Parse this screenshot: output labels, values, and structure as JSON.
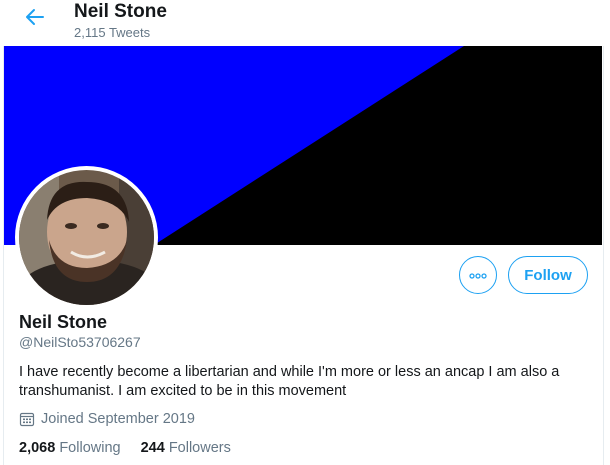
{
  "header": {
    "title": "Neil Stone",
    "subtitle": "2,115 Tweets",
    "back_icon": "arrow-left-icon"
  },
  "banner": {
    "colors": [
      "#0000ff",
      "#000000"
    ]
  },
  "profile": {
    "name": "Neil Stone",
    "handle": "@NeilSto53706267",
    "bio": "I have recently become a libertarian and while I'm more or less an ancap I am also a transhumanist. I am excited to be in this movement",
    "joined": "Joined September 2019",
    "joined_icon": "calendar-icon"
  },
  "actions": {
    "more_icon": "more-icon",
    "follow_label": "Follow"
  },
  "stats": {
    "following_count": "2,068",
    "following_label": "Following",
    "followers_count": "244",
    "followers_label": "Followers"
  },
  "colors": {
    "accent": "#1da1f2",
    "secondary_text": "#657786",
    "primary_text": "#14171a"
  }
}
